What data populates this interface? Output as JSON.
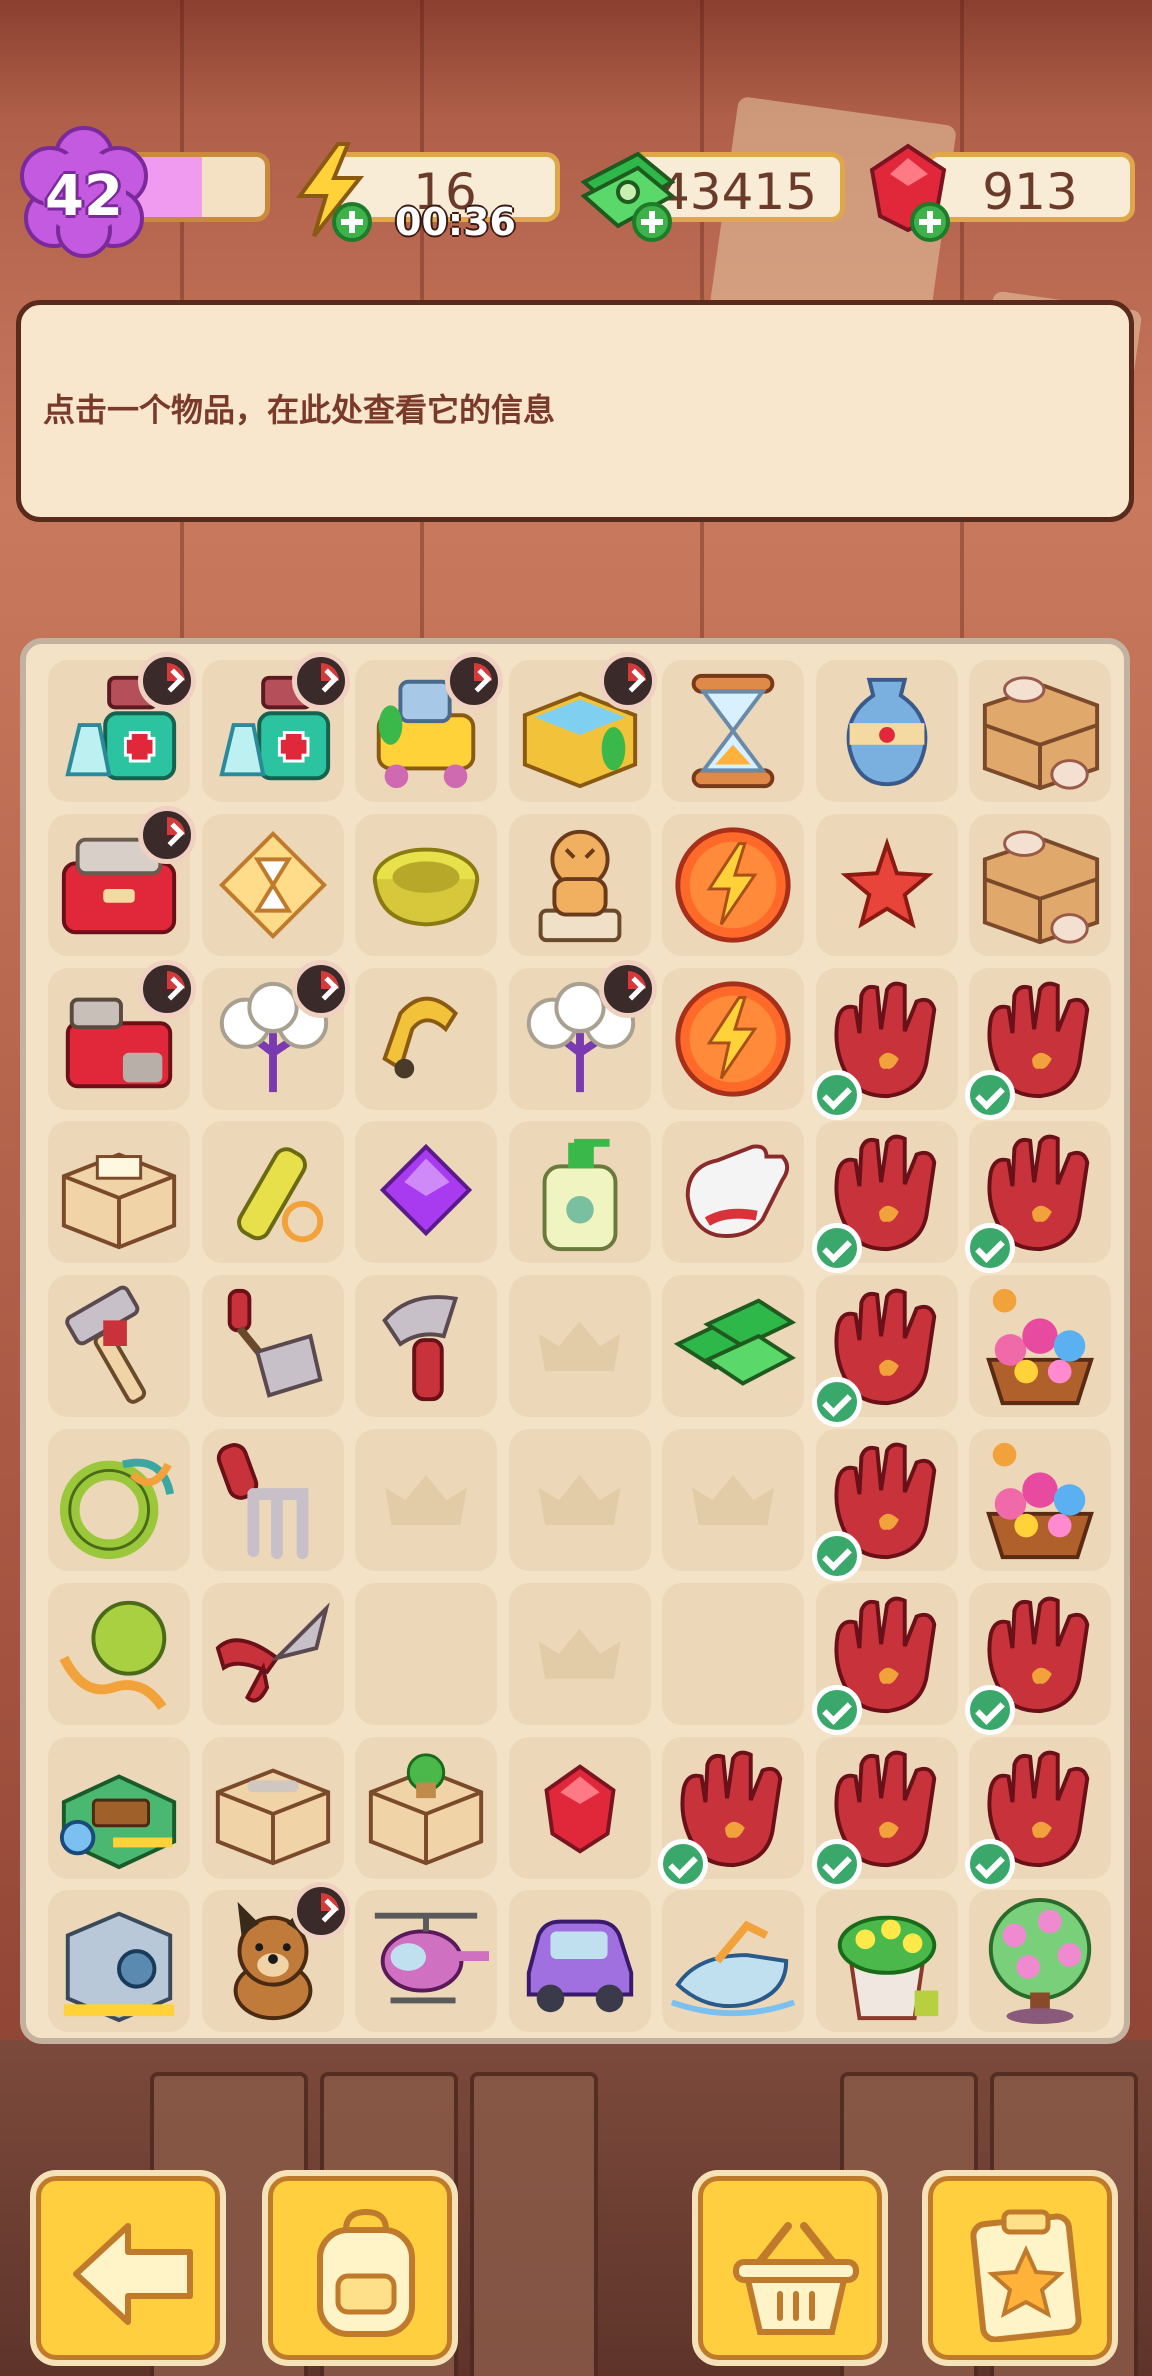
{
  "hud": {
    "level": "42",
    "xp_progress": 0.55,
    "energy": "16",
    "energy_timer": "00:36",
    "cash": "43415",
    "gems": "913"
  },
  "info_panel": {
    "text": "点击一个物品，在此处查看它的信息"
  },
  "board": {
    "columns": 7,
    "rows": 9,
    "cells": [
      [
        "first-aid-kit",
        "first-aid-kit",
        "toy-cart",
        "box-jar",
        "hourglass",
        "vase",
        "box-crate"
      ],
      [
        "toolbox",
        "hourglass-tile",
        "bowl",
        "tiger-statue",
        "energy-orb",
        "starfish",
        "box-crate"
      ],
      [
        "tool-chest",
        "cotton-plant",
        "ring-lure",
        "cotton-plant",
        "energy-orb",
        "red-glove",
        "red-glove"
      ],
      [
        "package-box",
        "flashlight",
        "purple-gem",
        "lotion-bottle",
        "white-glove",
        "red-glove",
        "red-glove"
      ],
      [
        "hammer-tool",
        "rake-tool",
        "axe-tool",
        "empty",
        "cash-stack",
        "red-glove",
        "flower-basket"
      ],
      [
        "rope-ring",
        "hand-rake",
        "empty",
        "empty",
        "empty",
        "red-glove",
        "flower-basket"
      ],
      [
        "ball-rope",
        "pruning-shears",
        "empty",
        "empty",
        "empty",
        "red-glove",
        "red-glove"
      ],
      [
        "park-bench-scene",
        "package-box-2",
        "plant-box",
        "red-gem",
        "red-glove",
        "red-glove",
        "red-glove"
      ],
      [
        "safe",
        "dog",
        "helicopter",
        "purple-car",
        "jet-ski",
        "flower-pot",
        "flower-tree"
      ]
    ],
    "timer_badges": [
      [
        0,
        0
      ],
      [
        0,
        1
      ],
      [
        0,
        2
      ],
      [
        0,
        3
      ],
      [
        1,
        0
      ],
      [
        2,
        0
      ],
      [
        2,
        1
      ],
      [
        2,
        3
      ],
      [
        8,
        1
      ]
    ],
    "check_badges": [
      [
        2,
        5
      ],
      [
        2,
        6
      ],
      [
        3,
        5
      ],
      [
        3,
        6
      ],
      [
        4,
        5
      ],
      [
        5,
        5
      ],
      [
        6,
        5
      ],
      [
        6,
        6
      ],
      [
        7,
        4
      ],
      [
        7,
        5
      ],
      [
        7,
        6
      ]
    ]
  },
  "buttons": {
    "back": "arrow-left-icon",
    "backpack": "backpack-icon",
    "shop": "basket-icon",
    "tasks": "clipboard-star-icon"
  },
  "colors": {
    "button_fill": "#ffcf3f",
    "xp_fill": "#f09af0",
    "check_green": "#3aa86a",
    "glove_red": "#c8323a"
  }
}
